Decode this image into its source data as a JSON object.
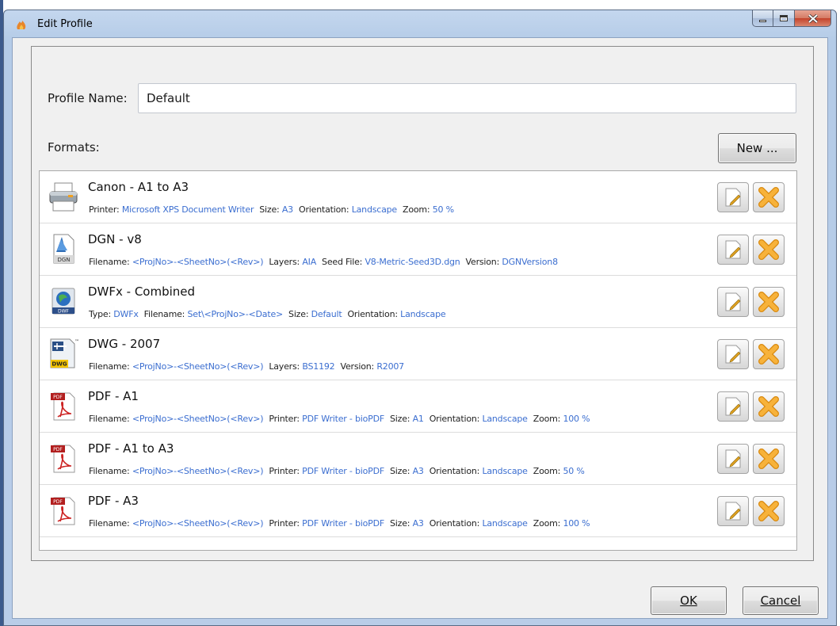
{
  "window": {
    "title": "Edit Profile",
    "controls": [
      "minimize-icon",
      "maximize-icon",
      "close-icon"
    ],
    "accent_color": "#b9cde8"
  },
  "form": {
    "profile_name_label": "Profile Name:",
    "profile_name_value": "Default",
    "formats_label": "Formats:",
    "new_button": "New ..."
  },
  "formats": [
    {
      "name": "Canon - A1 to A3",
      "icon": "printer-icon",
      "details": [
        {
          "k": "Printer:",
          "v": "Microsoft XPS Document Writer"
        },
        {
          "k": "Size:",
          "v": "A3"
        },
        {
          "k": "Orientation:",
          "v": "Landscape"
        },
        {
          "k": "Zoom:",
          "v": "50 %"
        }
      ]
    },
    {
      "name": "DGN - v8",
      "icon": "dgn-file-icon",
      "details": [
        {
          "k": "Filename:",
          "v": "<ProjNo>-<SheetNo>(<Rev>)"
        },
        {
          "k": "Layers:",
          "v": "AIA"
        },
        {
          "k": "Seed File:",
          "v": "V8-Metric-Seed3D.dgn"
        },
        {
          "k": "Version:",
          "v": "DGNVersion8"
        }
      ]
    },
    {
      "name": "DWFx - Combined",
      "icon": "dwf-file-icon",
      "details": [
        {
          "k": "Type:",
          "v": "DWFx"
        },
        {
          "k": "Filename:",
          "v": "Set\\<ProjNo>-<Date>"
        },
        {
          "k": "Size:",
          "v": "Default"
        },
        {
          "k": "Orientation:",
          "v": "Landscape"
        }
      ]
    },
    {
      "name": "DWG - 2007",
      "icon": "dwg-file-icon",
      "details": [
        {
          "k": "Filename:",
          "v": "<ProjNo>-<SheetNo>(<Rev>)"
        },
        {
          "k": "Layers:",
          "v": "BS1192"
        },
        {
          "k": "Version:",
          "v": "R2007"
        }
      ]
    },
    {
      "name": "PDF - A1",
      "icon": "pdf-file-icon",
      "details": [
        {
          "k": "Filename:",
          "v": "<ProjNo>-<SheetNo>(<Rev>)"
        },
        {
          "k": "Printer:",
          "v": "PDF Writer - bioPDF"
        },
        {
          "k": "Size:",
          "v": "A1"
        },
        {
          "k": "Orientation:",
          "v": "Landscape"
        },
        {
          "k": "Zoom:",
          "v": "100 %"
        }
      ]
    },
    {
      "name": "PDF - A1 to A3",
      "icon": "pdf-file-icon",
      "details": [
        {
          "k": "Filename:",
          "v": "<ProjNo>-<SheetNo>(<Rev>)"
        },
        {
          "k": "Printer:",
          "v": "PDF Writer - bioPDF"
        },
        {
          "k": "Size:",
          "v": "A3"
        },
        {
          "k": "Orientation:",
          "v": "Landscape"
        },
        {
          "k": "Zoom:",
          "v": "50 %"
        }
      ]
    },
    {
      "name": "PDF - A3",
      "icon": "pdf-file-icon",
      "details": [
        {
          "k": "Filename:",
          "v": "<ProjNo>-<SheetNo>(<Rev>)"
        },
        {
          "k": "Printer:",
          "v": "PDF Writer - bioPDF"
        },
        {
          "k": "Size:",
          "v": "A3"
        },
        {
          "k": "Orientation:",
          "v": "Landscape"
        },
        {
          "k": "Zoom:",
          "v": "100 %"
        }
      ]
    }
  ],
  "buttons": {
    "ok": "OK",
    "cancel": "Cancel"
  },
  "colors": {
    "detail_value": "#3b6ed0",
    "delete_x": "#f0a020"
  }
}
